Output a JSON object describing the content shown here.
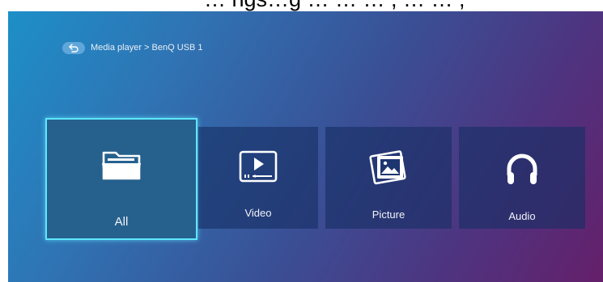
{
  "top_text": "… ngs…g  … … … , … … ,",
  "breadcrumb": {
    "back_icon": "back-arrow-icon",
    "path": "Media player > BenQ USB 1"
  },
  "tiles": [
    {
      "label": "All",
      "icon": "folder-icon",
      "selected": true
    },
    {
      "label": "Video",
      "icon": "video-player-icon",
      "selected": false
    },
    {
      "label": "Picture",
      "icon": "picture-icon",
      "selected": false
    },
    {
      "label": "Audio",
      "icon": "headphones-icon",
      "selected": false
    }
  ],
  "colors": {
    "accent_border": "#5fe6ff",
    "selected_tile": "#26618e",
    "tile_bg": "#1d3670",
    "back_pill": "#5fa6da"
  }
}
